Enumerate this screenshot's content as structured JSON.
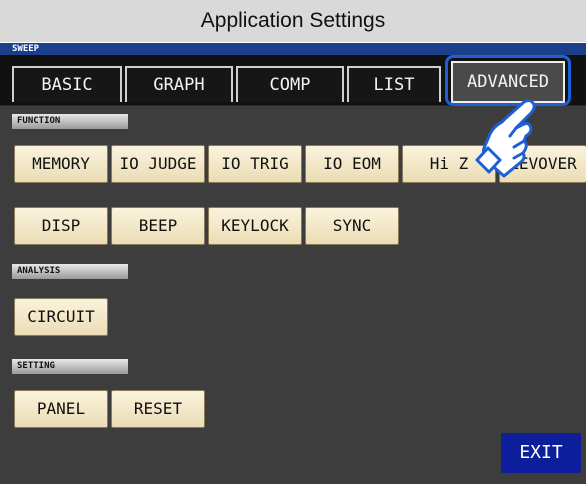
{
  "title": "Application Settings",
  "mode_label": "SWEEP",
  "tabs": [
    {
      "label": "BASIC",
      "active": false
    },
    {
      "label": "GRAPH",
      "active": false
    },
    {
      "label": "COMP",
      "active": false
    },
    {
      "label": "LIST",
      "active": false
    },
    {
      "label": "ADVANCED",
      "active": true
    }
  ],
  "sections": {
    "function": {
      "label": "FUNCTION",
      "buttons": [
        "MEMORY",
        "IO JUDGE",
        "IO TRIG",
        "IO EOM",
        "Hi Z",
        "LEVOVER",
        "DISP",
        "BEEP",
        "KEYLOCK",
        "SYNC"
      ]
    },
    "analysis": {
      "label": "ANALYSIS",
      "buttons": [
        "CIRCUIT"
      ]
    },
    "setting": {
      "label": "SETTING",
      "buttons": [
        "PANEL",
        "RESET"
      ]
    }
  },
  "exit_label": "EXIT",
  "colors": {
    "accent": "#1f5fd6",
    "exit_bg": "#0c1e9a",
    "button_bg": "#f5ecd0",
    "content_bg": "#3d3d3d",
    "mode_bar": "#1c3f8c"
  },
  "icons": {
    "pointer": "pointing-hand-icon"
  }
}
